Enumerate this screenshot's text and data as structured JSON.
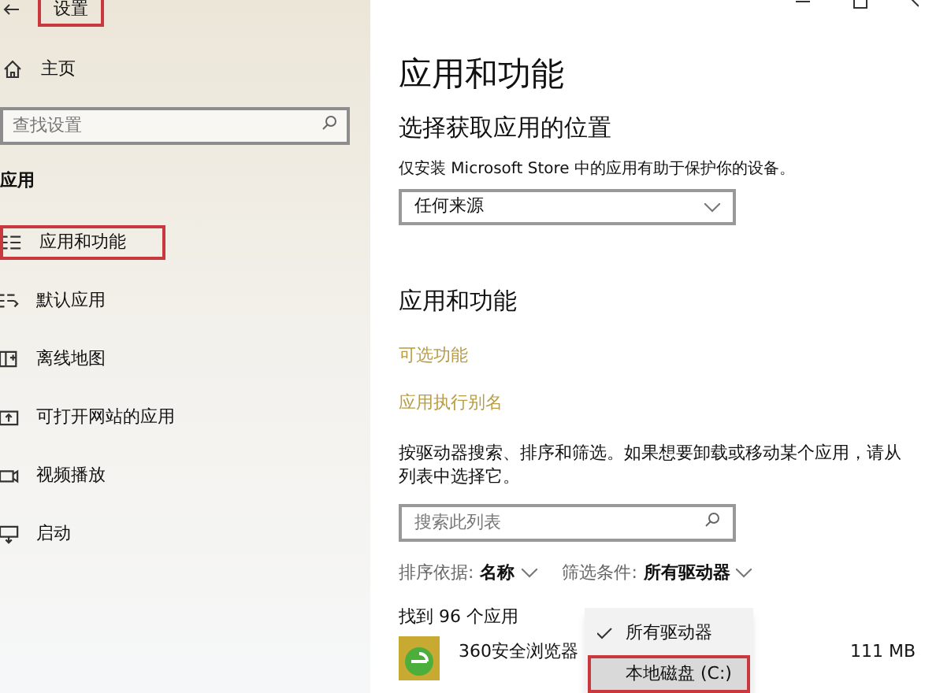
{
  "window": {
    "title": "设置",
    "title_annotated": true
  },
  "sidebar": {
    "home": "主页",
    "search": {
      "placeholder": "查找设置"
    },
    "section": "应用",
    "items": [
      {
        "label": "应用和功能",
        "annotated": true
      },
      {
        "label": "默认应用",
        "annotated": false
      },
      {
        "label": "离线地图",
        "annotated": false
      },
      {
        "label": "可打开网站的应用",
        "annotated": false
      },
      {
        "label": "视频播放",
        "annotated": false
      },
      {
        "label": "启动",
        "annotated": false
      }
    ]
  },
  "main": {
    "title": "应用和功能",
    "source_heading": "选择获取应用的位置",
    "source_desc": "仅安装 Microsoft Store 中的应用有助于保护你的设备。",
    "source_value": "任何来源",
    "apps_heading": "应用和功能",
    "links": [
      "可选功能",
      "应用执行别名"
    ],
    "apps_desc": "按驱动器搜索、排序和筛选。如果想要卸载或移动某个应用，请从列表中选择它。",
    "search": {
      "placeholder": "搜索此列表"
    },
    "sort": {
      "label": "排序依据:",
      "value": "名称"
    },
    "filter": {
      "label": "筛选条件:",
      "value": "所有驱动器"
    },
    "count": "找到 96 个应用",
    "filter_menu": [
      {
        "label": "所有驱动器",
        "checked": true,
        "selected": false,
        "annotated": false
      },
      {
        "label": "本地磁盘 (C:)",
        "checked": false,
        "selected": true,
        "annotated": true
      }
    ],
    "apps": [
      {
        "name": "360安全浏览器",
        "size": "111 MB"
      }
    ]
  }
}
